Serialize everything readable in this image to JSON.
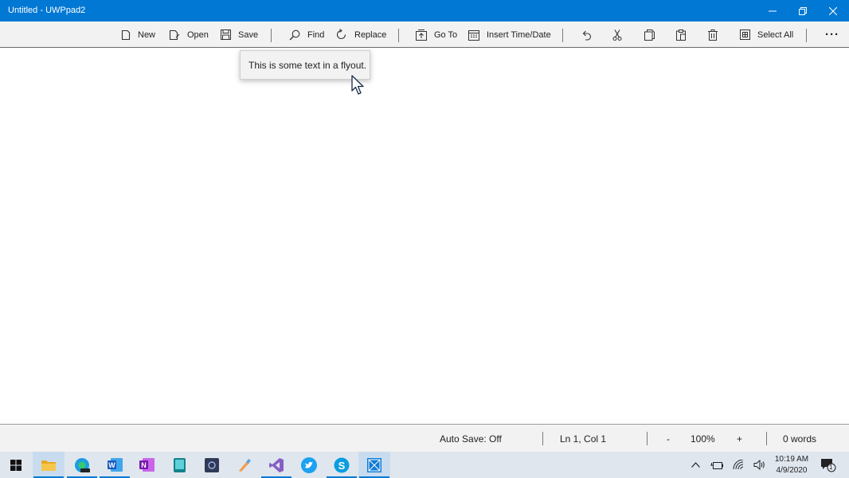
{
  "window": {
    "title": "Untitled - UWPpad2"
  },
  "toolbar": {
    "new_label": "New",
    "open_label": "Open",
    "save_label": "Save",
    "find_label": "Find",
    "replace_label": "Replace",
    "goto_label": "Go To",
    "insert_time_label": "Insert Time/Date",
    "select_all_label": "Select All",
    "more_label": "···",
    "icons": [
      "new-icon",
      "open-icon",
      "save-icon",
      "find-icon",
      "replace-icon",
      "goto-icon",
      "calendar-icon",
      "undo-icon",
      "cut-icon",
      "copy-icon",
      "paste-icon",
      "delete-icon",
      "select-all-icon",
      "more-icon"
    ]
  },
  "flyout": {
    "text": "This is some text in a flyout."
  },
  "status": {
    "autosave": "Auto Save: Off",
    "position": "Ln 1, Col 1",
    "zoom_out": "-",
    "zoom": "100%",
    "zoom_in": "+",
    "words": "0 words"
  },
  "taskbar": {
    "apps": [
      "windows-start",
      "file-explorer",
      "edge-beta",
      "word",
      "onenote",
      "book-app",
      "camera-app",
      "paint-app",
      "visual-studio",
      "twitter",
      "skype",
      "uwppad2"
    ],
    "time": "10:19 AM",
    "date": "4/9/2020",
    "notification_count": "1"
  },
  "colors": {
    "accent": "#0078d4",
    "toolbar_bg": "#f2f2f2",
    "taskbar_bg": "#dfe6ee"
  }
}
